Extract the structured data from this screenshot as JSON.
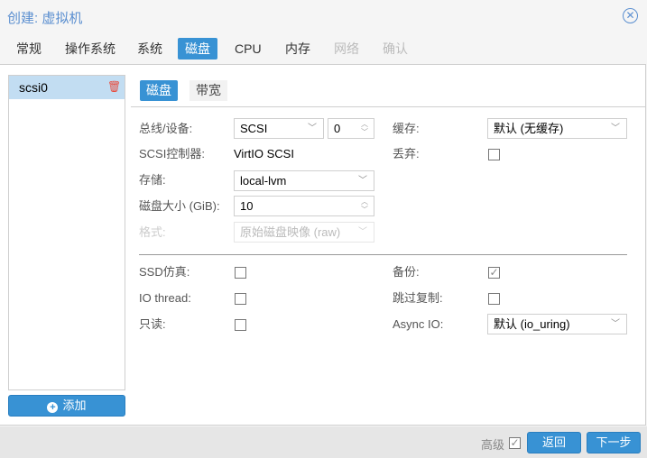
{
  "window": {
    "title": "创建: 虚拟机"
  },
  "tabs": [
    {
      "label": "常规"
    },
    {
      "label": "操作系统"
    },
    {
      "label": "系统"
    },
    {
      "label": "磁盘"
    },
    {
      "label": "CPU"
    },
    {
      "label": "内存"
    },
    {
      "label": "网络"
    },
    {
      "label": "确认"
    }
  ],
  "disk_list": {
    "items": [
      {
        "label": "scsi0"
      }
    ],
    "add_label": "添加"
  },
  "inner_tabs": [
    {
      "label": "磁盘"
    },
    {
      "label": "带宽"
    }
  ],
  "form": {
    "bus_label": "总线/设备:",
    "bus_value": "SCSI",
    "device_value": "0",
    "controller_label": "SCSI控制器:",
    "controller_value": "VirtIO SCSI",
    "storage_label": "存储:",
    "storage_value": "local-lvm",
    "size_label": "磁盘大小 (GiB):",
    "size_value": "10",
    "format_label": "格式:",
    "format_value": "原始磁盘映像 (raw)",
    "cache_label": "缓存:",
    "cache_value": "默认 (无缓存)",
    "discard_label": "丢弃:",
    "discard_checked": false,
    "ssd_label": "SSD仿真:",
    "ssd_checked": false,
    "iothread_label": "IO thread:",
    "iothread_checked": false,
    "readonly_label": "只读:",
    "readonly_checked": false,
    "backup_label": "备份:",
    "backup_checked": true,
    "skiprep_label": "跳过复制:",
    "skiprep_checked": false,
    "asyncio_label": "Async IO:",
    "asyncio_value": "默认 (io_uring)"
  },
  "footer": {
    "advanced_label": "高级",
    "advanced_checked": true,
    "back_label": "返回",
    "next_label": "下一步"
  }
}
